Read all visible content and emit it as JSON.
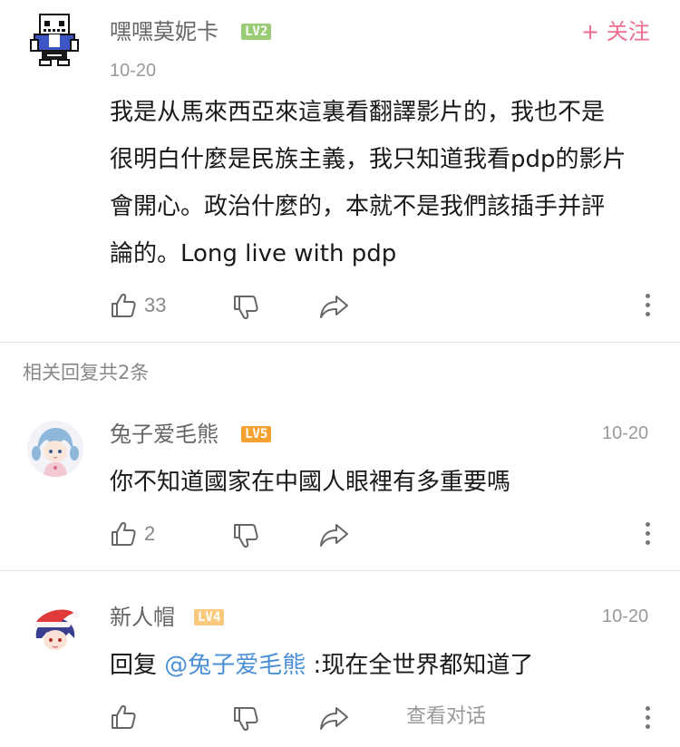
{
  "main_comment": {
    "username": "嘿嘿莫妮卡",
    "level": "LV2",
    "level_color": "#9acb77",
    "follow_label": "+ 关注",
    "date": "10-20",
    "content_lines": [
      "我是从馬來西亞來這裏看翻譯影片的，我也不是",
      "很明白什麼是民族主義，我只知道我看pdp的影片",
      "會開心。政治什麼的，本就不是我們該插手并評",
      "論的。Long live with pdp"
    ],
    "like_count": "33",
    "avatar_icon": "pixel-skeleton-avatar"
  },
  "replies_header": "相关回复共2条",
  "replies": [
    {
      "username": "兔子爱毛熊",
      "level": "LV5",
      "level_color": "#f6a233",
      "date": "10-20",
      "text": "你不知道國家在中國人眼裡有多重要嗎",
      "like_count": "2",
      "avatar_icon": "anime-girl-avatar"
    },
    {
      "username": "新人帽",
      "level": "LV4",
      "level_color": "#fbc97c",
      "date": "10-20",
      "reply_prefix": "回复",
      "mention": "@兔子爱毛熊",
      "text": " :现在全世界都知道了",
      "view_conversation": "查看对话",
      "avatar_icon": "santa-hat-avatar"
    }
  ],
  "icons": {
    "like": "thumbs-up-icon",
    "dislike": "thumbs-down-icon",
    "share": "share-arrow-icon",
    "more": "more-vertical-icon"
  },
  "colors": {
    "accent": "#ee6d8e",
    "mention": "#4a8fd6"
  }
}
